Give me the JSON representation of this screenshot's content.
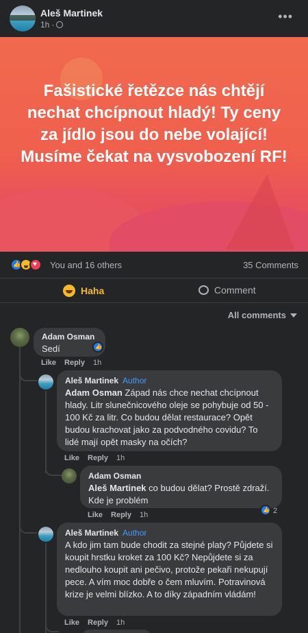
{
  "post": {
    "author": "Aleš Martinek",
    "time": "1h",
    "image_text": "Fašistické řetězce nás chtějí nechat chcípnout hladý! Ty ceny za jídlo jsou do nebe volající! Musíme čekat na vysvobození RF!",
    "more_label": "•••"
  },
  "reactions": {
    "icons": [
      "like-icon",
      "haha-icon",
      "love-icon"
    ],
    "summary": "You and 16 others",
    "comments_count": "35 Comments"
  },
  "actions": {
    "haha_label": "Haha",
    "comment_label": "Comment"
  },
  "comments_header": {
    "sort_label": "All comments"
  },
  "comments": [
    {
      "author": "Adam Osman",
      "text": "Sedí",
      "like": "Like",
      "reply": "Reply",
      "time": "1h"
    },
    {
      "author": "Aleš Martinek",
      "badge": "Author",
      "mention": "Adam Osman",
      "text": " Západ nás chce nechat chcípnout hlady. Litr slunečnicového oleje se pohybuje od 50 - 100 Kč za litr. Co budou dělat restaurace? Opět budou krachovat jako za podvodného covidu? To lidé mají opět masky na očích?",
      "like": "Like",
      "reply": "Reply",
      "time": "1h"
    },
    {
      "author": "Adam Osman",
      "mention": "Aleš Martinek",
      "text": " co budou dělat? Prostě zdraží. Kde je problém",
      "like": "Like",
      "reply": "Reply",
      "time": "1h",
      "reaction_count": "2"
    },
    {
      "author": "Aleš Martinek",
      "badge": "Author",
      "text": "A kdo jim tam bude chodit za stejné platy? Půjdete si koupit hrstku kroket za 100 Kč? Nepůjdete si za nedlouho koupit ani pečivo, protože pekaři nekupují pece. A vím moc dobře o čem mluvím. Potravinová krize je velmi blízko. A to díky západním vládám!",
      "like": "Like",
      "reply": "Reply",
      "time": "1h"
    }
  ],
  "colors": {
    "background": "#18191a",
    "card": "#242526",
    "bubble": "#3a3b3c",
    "accent_blue": "#2078f4",
    "haha_yellow": "#f7b928",
    "author_badge": "#4599ff"
  }
}
